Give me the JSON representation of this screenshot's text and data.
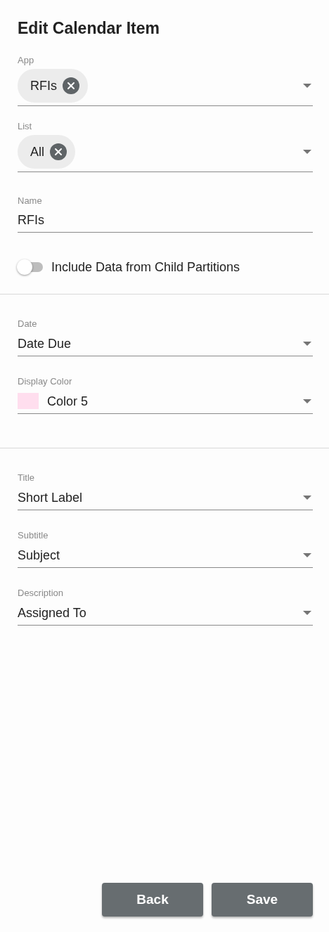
{
  "title": "Edit Calendar Item",
  "sections": [
    {
      "fields": [
        {
          "kind": "chips",
          "label": "App",
          "chips": [
            "RFIs"
          ]
        },
        {
          "kind": "chips",
          "label": "List",
          "chips": [
            "All"
          ]
        },
        {
          "kind": "text",
          "label": "Name",
          "value": "RFIs"
        },
        {
          "kind": "toggle",
          "label": "Include Data from Child Partitions",
          "on": false
        }
      ]
    },
    {
      "fields": [
        {
          "kind": "select",
          "label": "Date",
          "value": "Date Due"
        },
        {
          "kind": "color",
          "label": "Display Color",
          "value": "Color 5",
          "color": "#ffdeee"
        }
      ]
    },
    {
      "fields": [
        {
          "kind": "select",
          "label": "Title",
          "value": "Short Label"
        },
        {
          "kind": "select",
          "label": "Subtitle",
          "value": "Subject"
        },
        {
          "kind": "select",
          "label": "Description",
          "value": "Assigned To"
        }
      ]
    }
  ],
  "buttons": [
    "Back",
    "Save"
  ]
}
